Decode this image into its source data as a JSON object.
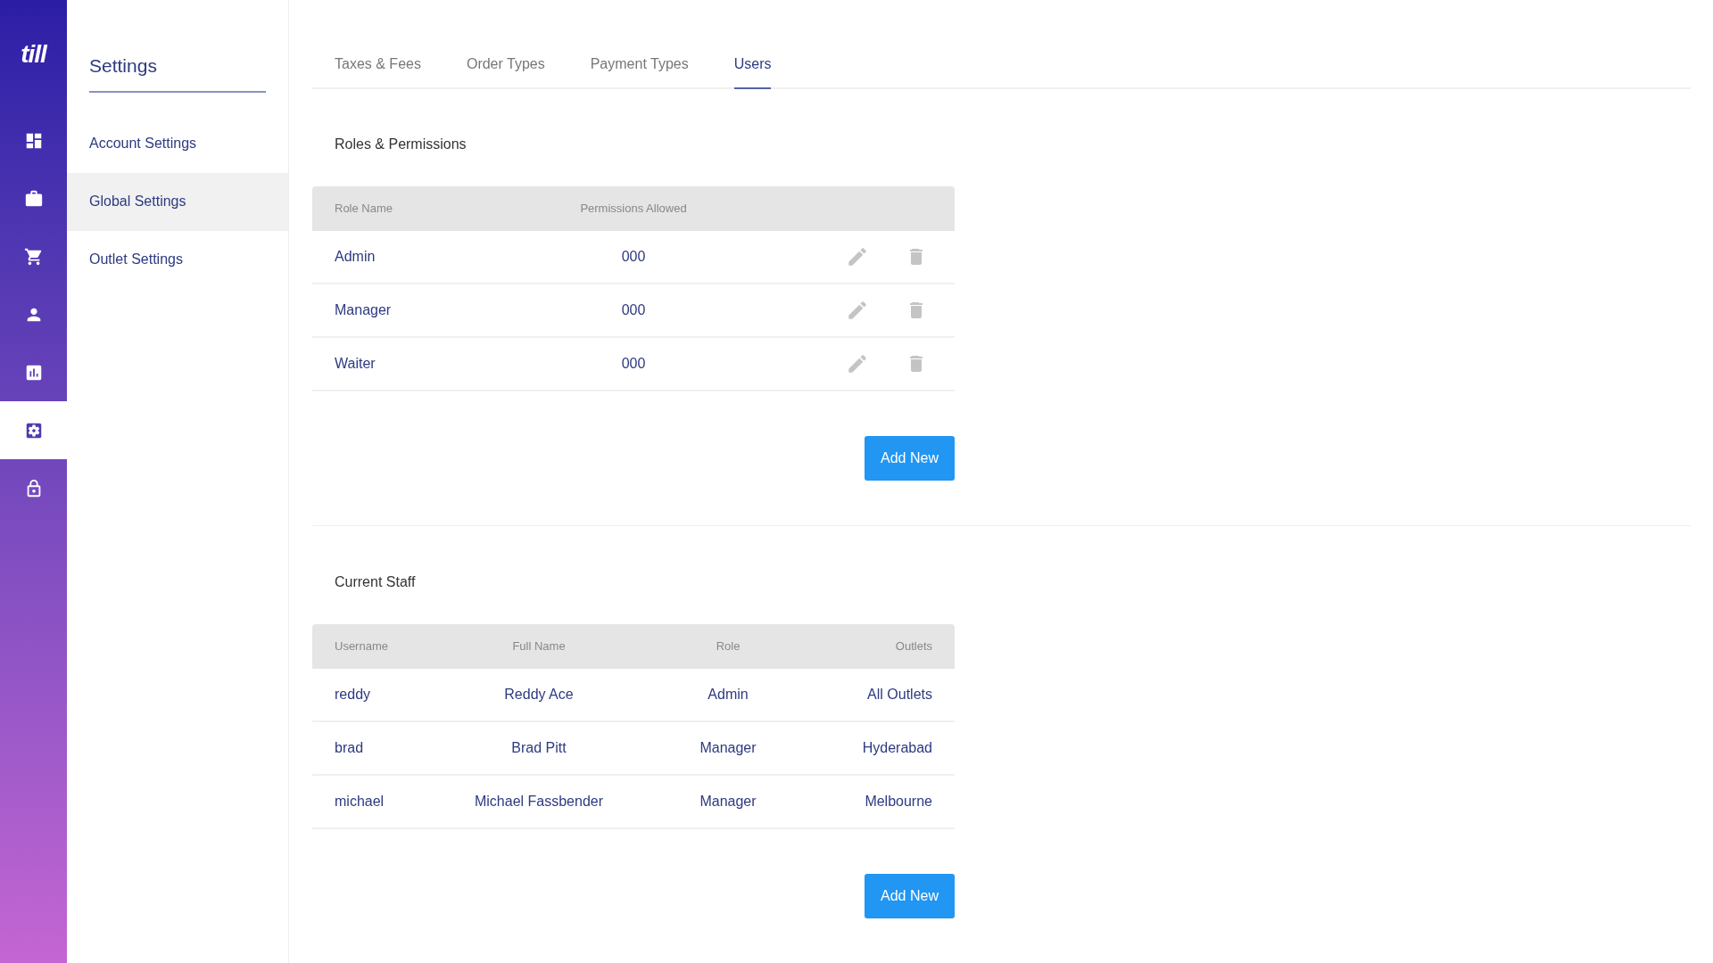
{
  "brand": "till",
  "nav": [
    {
      "selected": false
    },
    {
      "selected": false
    },
    {
      "selected": false
    },
    {
      "selected": false
    },
    {
      "selected": false
    },
    {
      "selected": true
    },
    {
      "selected": false
    }
  ],
  "settings_menu": {
    "title": "Settings",
    "items": [
      {
        "label": "Account Settings",
        "selected": false
      },
      {
        "label": "Global Settings",
        "selected": true
      },
      {
        "label": "Outlet Settings",
        "selected": false
      }
    ]
  },
  "tabs": [
    {
      "label": "Taxes & Fees",
      "selected": false
    },
    {
      "label": "Order Types",
      "selected": false
    },
    {
      "label": "Payment Types",
      "selected": false
    },
    {
      "label": "Users",
      "selected": true
    }
  ],
  "roles": {
    "title": "Roles & Permissions",
    "columns": [
      "Role Name",
      "Permissions Allowed"
    ],
    "rows": [
      {
        "name": "Admin",
        "permissions": "000"
      },
      {
        "name": "Manager",
        "permissions": "000"
      },
      {
        "name": "Waiter",
        "permissions": "000"
      }
    ],
    "button": "Add New"
  },
  "staff": {
    "title": "Current Staff",
    "columns": [
      "Username",
      "Full Name",
      "Role",
      "Outlets"
    ],
    "rows": [
      {
        "username": "reddy",
        "full_name": "Reddy Ace",
        "role": "Admin",
        "outlets": "All Outlets"
      },
      {
        "username": "brad",
        "full_name": "Brad Pitt",
        "role": "Manager",
        "outlets": "Hyderabad"
      },
      {
        "username": "michael",
        "full_name": "Michael Fassbender",
        "role": "Manager",
        "outlets": "Melbourne"
      }
    ],
    "button": "Add New"
  }
}
